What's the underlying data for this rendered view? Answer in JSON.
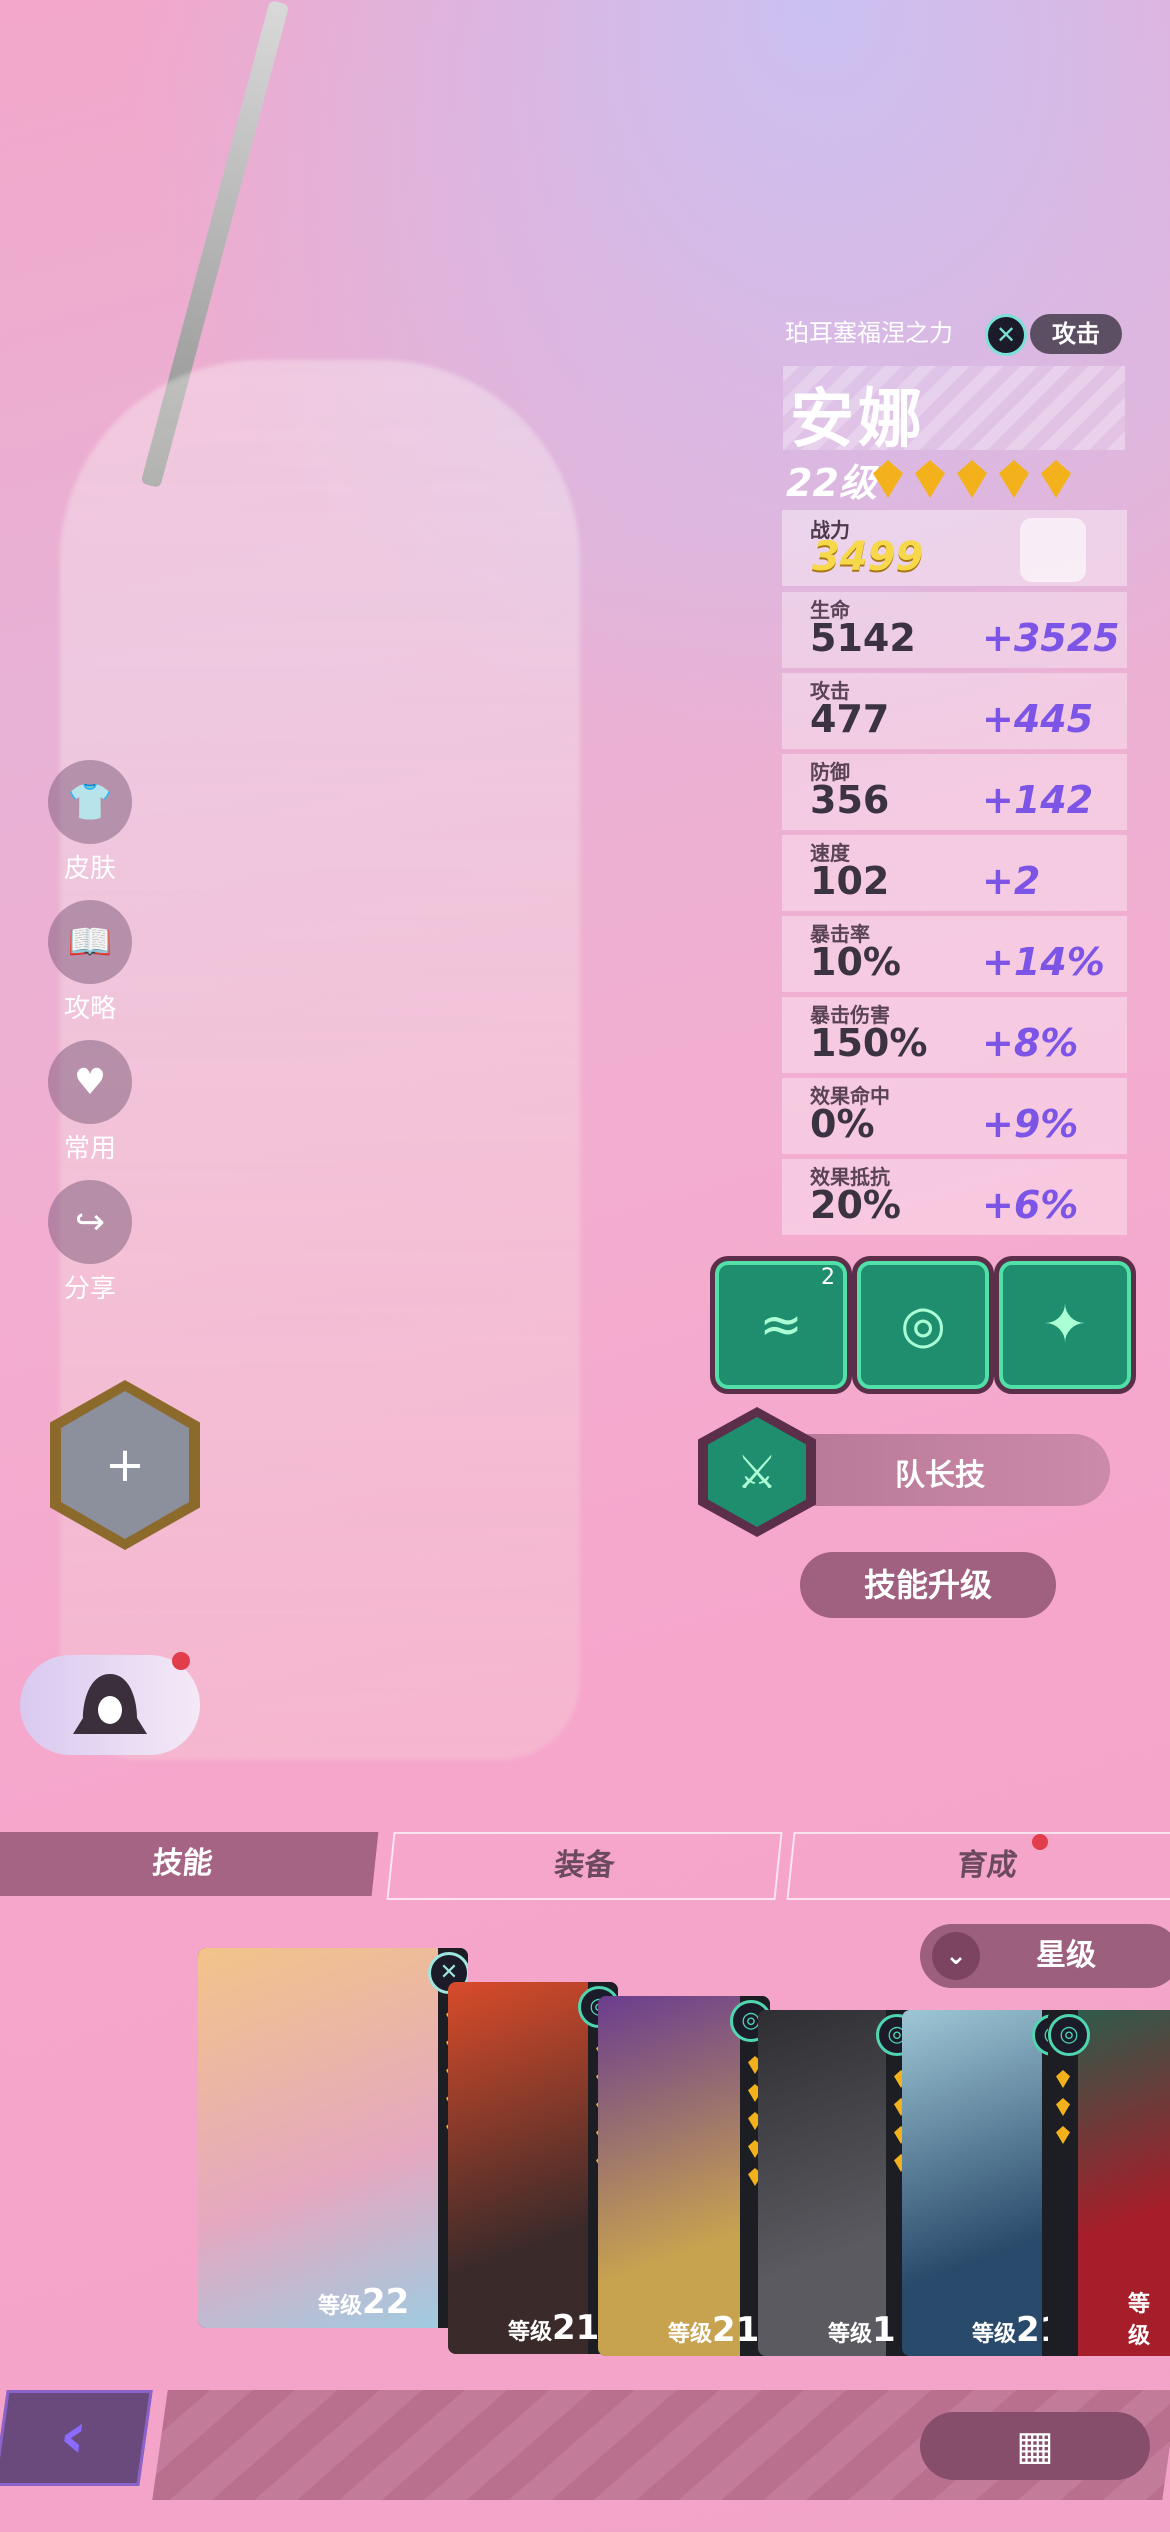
{
  "hero": {
    "faction": "珀耳塞福涅之力",
    "role_tag": "攻击",
    "name": "安娜",
    "level": "22级",
    "stars": 5,
    "power_label": "战力",
    "power_value": "3499"
  },
  "stats": [
    {
      "label": "生命",
      "value": "5142",
      "bonus": "+3525"
    },
    {
      "label": "攻击",
      "value": "477",
      "bonus": "+445"
    },
    {
      "label": "防御",
      "value": "356",
      "bonus": "+142"
    },
    {
      "label": "速度",
      "value": "102",
      "bonus": "+2"
    },
    {
      "label": "暴击率",
      "value": "10%",
      "bonus": "+14%"
    },
    {
      "label": "暴击伤害",
      "value": "150%",
      "bonus": "+8%"
    },
    {
      "label": "效果命中",
      "value": "0%",
      "bonus": "+9%"
    },
    {
      "label": "效果抵抗",
      "value": "20%",
      "bonus": "+6%"
    }
  ],
  "side_menu": [
    {
      "label": "皮肤",
      "icon": "shirt-icon",
      "glyph": "👕"
    },
    {
      "label": "攻略",
      "icon": "book-icon",
      "glyph": "📖"
    },
    {
      "label": "常用",
      "icon": "heart-icon",
      "glyph": "♥"
    },
    {
      "label": "分享",
      "icon": "share-icon",
      "glyph": "↪"
    }
  ],
  "skills": {
    "skill1_badge": "2",
    "leader_label": "队长技",
    "upgrade_label": "技能升级"
  },
  "tabs": [
    "技能",
    "装备",
    "育成"
  ],
  "sort": {
    "label": "星级"
  },
  "cards": [
    {
      "level_label": "等级",
      "level": "22",
      "color": "#e8b98a"
    },
    {
      "level_label": "等级",
      "level": "21",
      "color": "#c9462a"
    },
    {
      "level_label": "等级",
      "level": "21",
      "color": "#6b3d8f"
    },
    {
      "level_label": "等级",
      "level": "1",
      "color": "#3b3b3f"
    },
    {
      "level_label": "等级",
      "level": "21",
      "color": "#35607a"
    },
    {
      "level_label": "等级",
      "level": "",
      "color": "#8a1e2a"
    }
  ],
  "colors": {
    "accent_purple": "#7c55e6",
    "power_gold": "#f7d84a",
    "skill_green": "#1e8e6e"
  }
}
